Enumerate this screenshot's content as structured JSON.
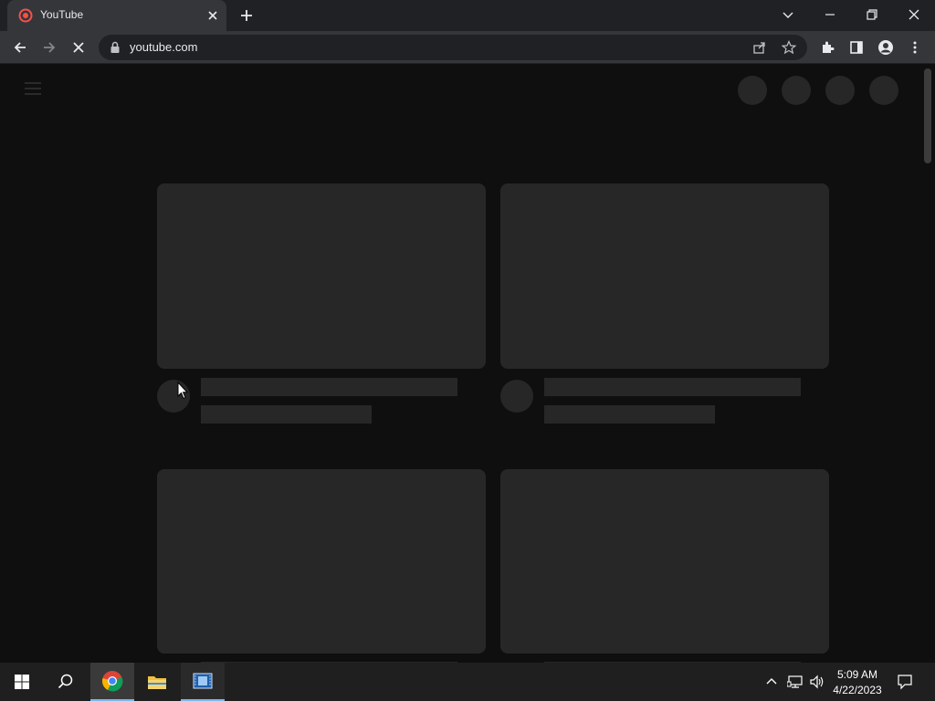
{
  "browser": {
    "tab": {
      "title": "YouTube",
      "favicon_icon": "youtube-loading-icon"
    },
    "address": {
      "url": "youtube.com"
    },
    "colors": {
      "frame": "#202124",
      "toolbar": "#35363a",
      "page": "#0f0f0f",
      "skeleton": "#272727"
    }
  },
  "page": {
    "header": {
      "menu_icon": "hamburger-icon",
      "placeholder_buttons": 4
    },
    "video_skeletons": 4
  },
  "taskbar": {
    "apps": [
      "start",
      "search",
      "chrome",
      "file-explorer",
      "video-editor"
    ],
    "clock": {
      "time": "5:09 AM",
      "date": "4/22/2023"
    }
  }
}
